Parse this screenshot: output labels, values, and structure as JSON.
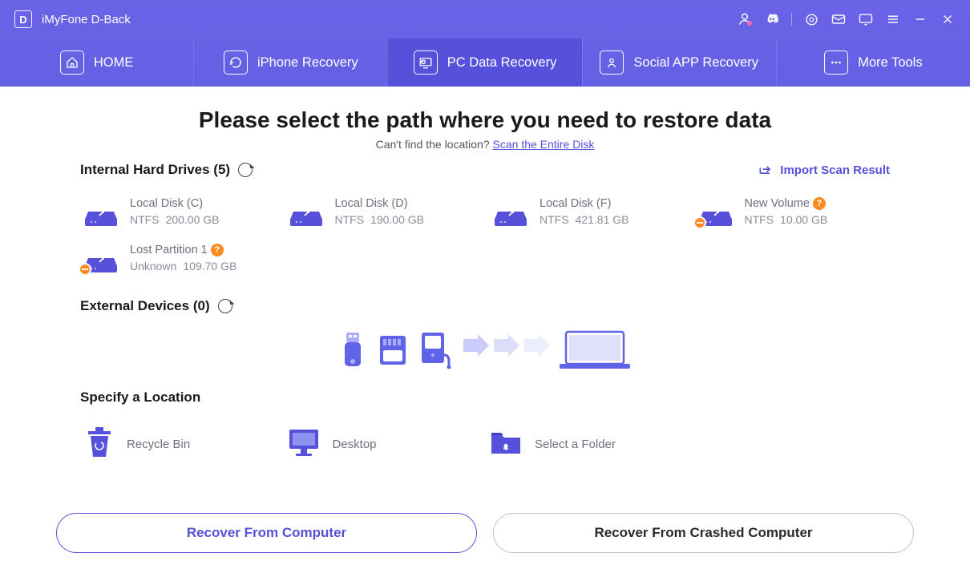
{
  "app": {
    "title": "iMyFone D-Back",
    "logo_letter": "D"
  },
  "tabs": [
    {
      "label": "HOME"
    },
    {
      "label": "iPhone Recovery"
    },
    {
      "label": "PC Data Recovery"
    },
    {
      "label": "Social APP Recovery"
    },
    {
      "label": "More Tools"
    }
  ],
  "hero": {
    "title": "Please select the path where you need to restore data",
    "subtitle_prefix": "Can't find the location? ",
    "subtitle_link": "Scan the Entire Disk"
  },
  "import_label": "Import Scan Result",
  "sections": {
    "internal": {
      "title_prefix": "Internal Hard Drives",
      "count": "(5)"
    },
    "external": {
      "title_prefix": "External Devices",
      "count": "(0)"
    },
    "specify": {
      "title": "Specify a Location"
    }
  },
  "drives": [
    {
      "name": "Local Disk (C)",
      "fs": "NTFS",
      "size": "200.00 GB",
      "warn": false,
      "help": false
    },
    {
      "name": "Local Disk (D)",
      "fs": "NTFS",
      "size": "190.00 GB",
      "warn": false,
      "help": false
    },
    {
      "name": "Local Disk (F)",
      "fs": "NTFS",
      "size": "421.81 GB",
      "warn": false,
      "help": false
    },
    {
      "name": "New Volume",
      "fs": "NTFS",
      "size": "10.00 GB",
      "warn": true,
      "help": true
    },
    {
      "name": "Lost Partition 1",
      "fs": "Unknown",
      "size": "109.70 GB",
      "warn": true,
      "help": true
    }
  ],
  "locations": [
    {
      "label": "Recycle Bin"
    },
    {
      "label": "Desktop"
    },
    {
      "label": "Select a Folder"
    }
  ],
  "footer": {
    "btn_primary": "Recover From Computer",
    "btn_secondary": "Recover From Crashed Computer"
  },
  "colors": {
    "accent": "#5750db",
    "accent_light": "#a9aef9",
    "text_muted": "#8b8b9a"
  }
}
